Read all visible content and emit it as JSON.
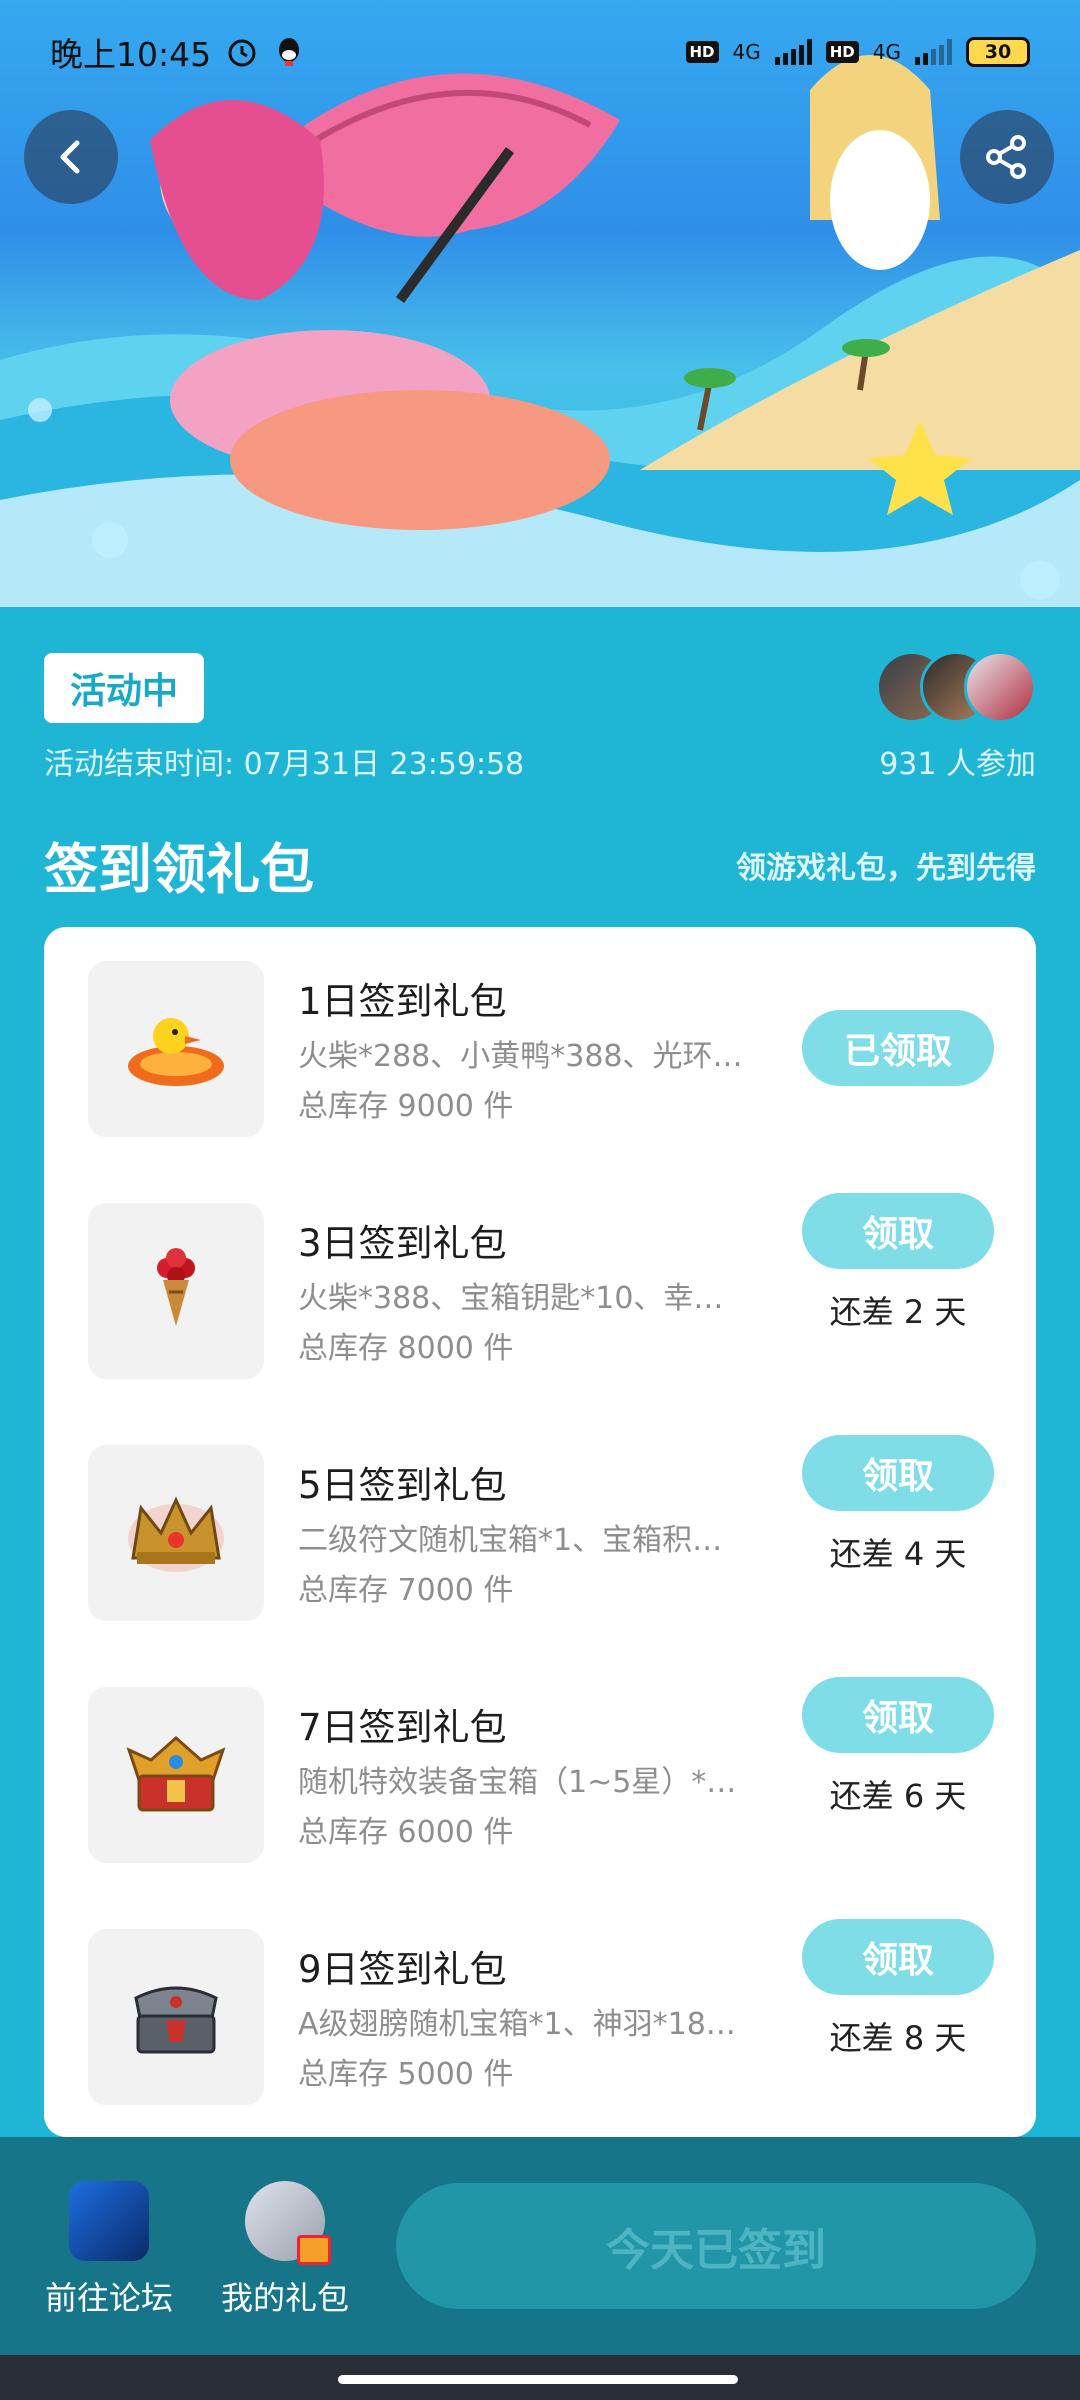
{
  "status_bar": {
    "time": "晚上10:45",
    "battery": "30",
    "network_label": "4G",
    "hd_label": "HD"
  },
  "header": {
    "back_icon": "chevron-left-icon",
    "share_icon": "share-icon"
  },
  "activity": {
    "status_badge": "活动中",
    "end_time": "活动结束时间: 07月31日 23:59:58",
    "participants": "931 人参加"
  },
  "section": {
    "title": "签到领礼包",
    "subtitle": "领游戏礼包，先到先得"
  },
  "gifts": [
    {
      "title": "1日签到礼包",
      "desc": "火柴*288、小黄鸭*388、光环…",
      "stock": "总库存 9000 件",
      "button": "已领取",
      "remain": "",
      "icon": "rubber-duck-icon"
    },
    {
      "title": "3日签到礼包",
      "desc": "火柴*388、宝箱钥匙*10、幸…",
      "stock": "总库存 8000 件",
      "button": "领取",
      "remain": "还差 2 天",
      "icon": "rose-bouquet-icon"
    },
    {
      "title": "5日签到礼包",
      "desc": "二级符文随机宝箱*1、宝箱积…",
      "stock": "总库存 7000 件",
      "button": "领取",
      "remain": "还差 4 天",
      "icon": "golden-crown-icon"
    },
    {
      "title": "7日签到礼包",
      "desc": "随机特效装备宝箱（1~5星）*…",
      "stock": "总库存 6000 件",
      "button": "领取",
      "remain": "还差 6 天",
      "icon": "treasure-chest-icon"
    },
    {
      "title": "9日签到礼包",
      "desc": "A级翅膀随机宝箱*1、神羽*18…",
      "stock": "总库存 5000 件",
      "button": "领取",
      "remain": "还差 8 天",
      "icon": "silver-chest-icon"
    }
  ],
  "bottom": {
    "forum_label": "前往论坛",
    "gifts_label": "我的礼包",
    "signed_button": "今天已签到"
  },
  "colors": {
    "background": "#1fb6d6",
    "button": "#7fdde8",
    "bottom_bar": "#17758a"
  }
}
